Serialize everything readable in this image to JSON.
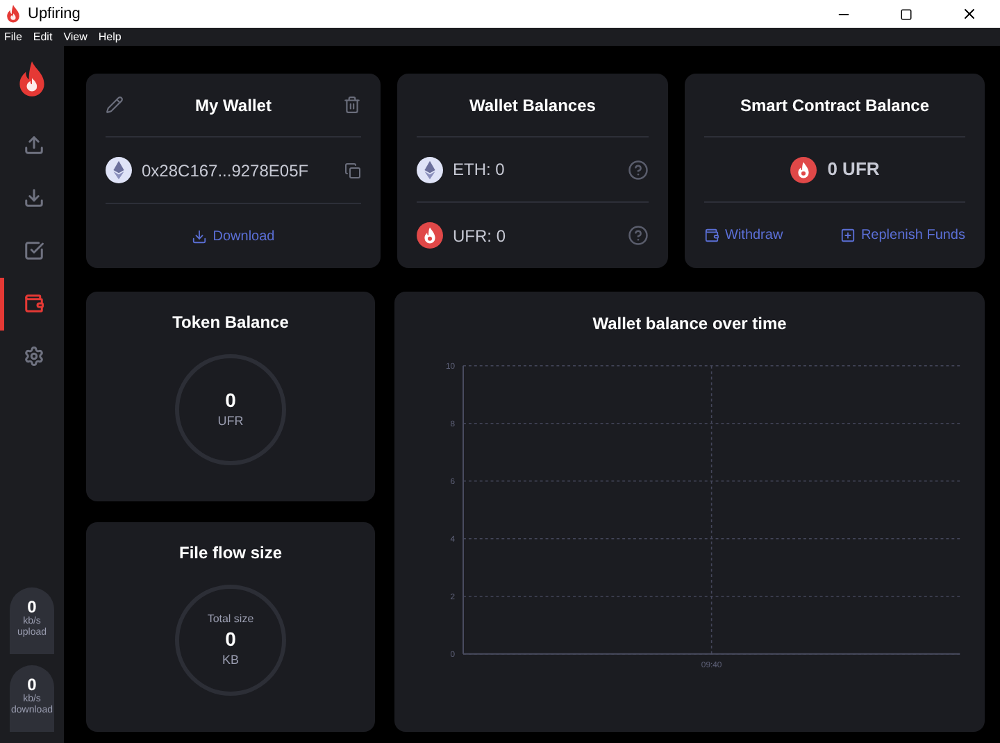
{
  "window": {
    "title": "Upfiring"
  },
  "menu": [
    "File",
    "Edit",
    "View",
    "Help"
  ],
  "nav": [
    {
      "kind": "upload",
      "selected": false
    },
    {
      "kind": "download",
      "selected": false
    },
    {
      "kind": "tasks",
      "selected": false
    },
    {
      "kind": "wallet",
      "selected": true
    },
    {
      "kind": "settings",
      "selected": false
    }
  ],
  "speeds": [
    {
      "value": "0",
      "unit": "kb/s",
      "label": "upload"
    },
    {
      "value": "0",
      "unit": "kb/s",
      "label": "download"
    }
  ],
  "my_wallet": {
    "title": "My Wallet",
    "address": "0x28C167...9278E05F",
    "download": "Download"
  },
  "wallet_balances": {
    "title": "Wallet Balances",
    "rows": [
      {
        "kind": "eth",
        "text": "ETH: 0"
      },
      {
        "kind": "ufr",
        "text": "UFR: 0"
      }
    ]
  },
  "smart_contract": {
    "title": "Smart Contract Balance",
    "amount": "0 UFR",
    "actions": [
      {
        "kind": "withdraw",
        "label": "Withdraw"
      },
      {
        "kind": "replenish",
        "label": "Replenish Funds"
      }
    ]
  },
  "token_balance": {
    "title": "Token Balance",
    "value": "0",
    "unit": "UFR"
  },
  "file_flow": {
    "title": "File flow size",
    "caption": "Total size",
    "value": "0",
    "unit": "KB"
  },
  "balance_chart": {
    "title": "Wallet balance over time",
    "chart_data": {
      "type": "line",
      "categories": [
        "09:40"
      ],
      "grid": true,
      "ylim": [
        0,
        10
      ],
      "yticks": [
        0,
        2,
        4,
        6,
        8,
        10
      ]
    }
  }
}
